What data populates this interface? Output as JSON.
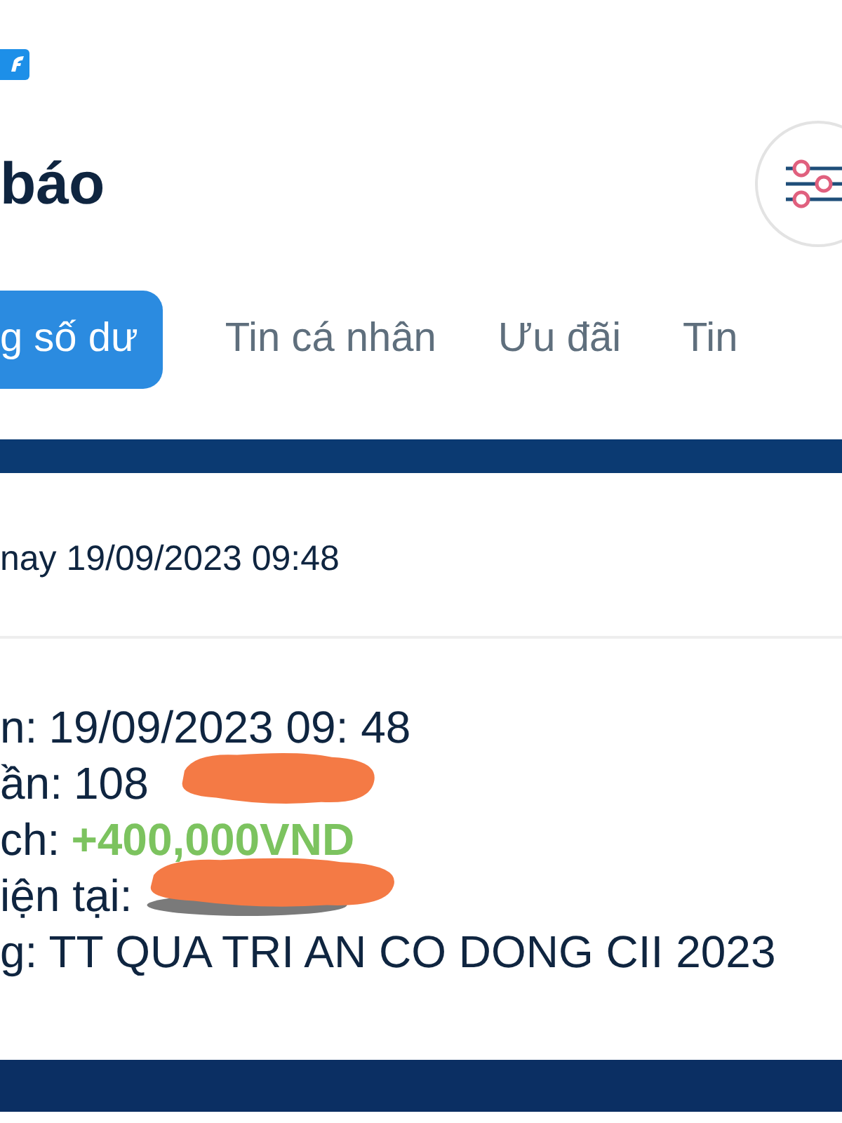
{
  "header": {
    "title": "báo"
  },
  "tabs": [
    {
      "label": "g số dư",
      "selected": true
    },
    {
      "label": "Tin cá nhân",
      "selected": false
    },
    {
      "label": "Ưu đãi",
      "selected": false
    },
    {
      "label": "Tin",
      "selected": false
    }
  ],
  "notification": {
    "date_line": "nay 19/09/2023 09:48",
    "details": [
      {
        "label": "n:",
        "value": "19/09/2023 09: 48",
        "kind": "plain"
      },
      {
        "label": "ần:",
        "value": "108",
        "kind": "plain"
      },
      {
        "label": "ch:",
        "value": "+400,000VND",
        "kind": "amount"
      },
      {
        "label": "iện tại:"
      },
      {
        "label": "g:",
        "value": "TT QUA TRI AN CO DONG CII 2023",
        "kind": "plain"
      }
    ]
  }
}
